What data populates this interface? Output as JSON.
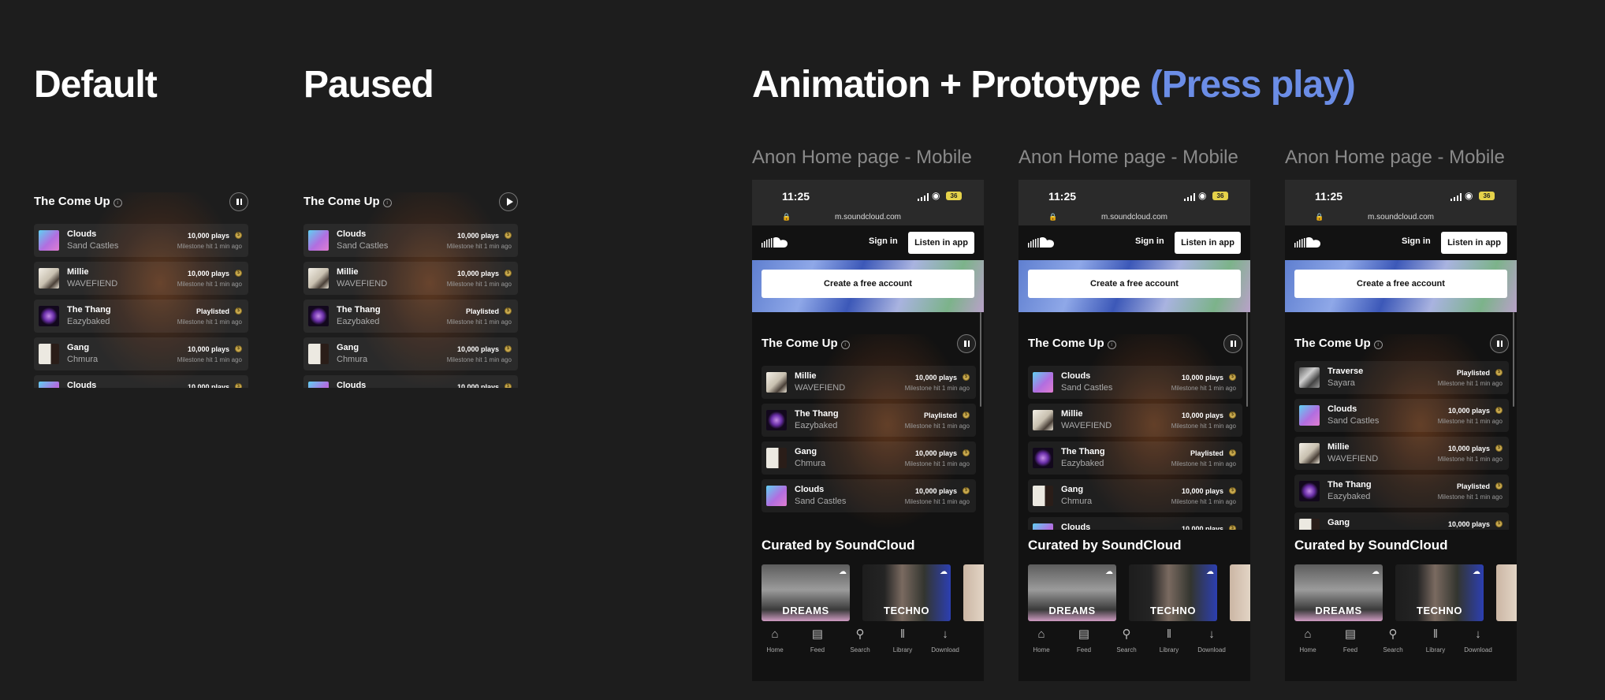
{
  "headings": {
    "default": "Default",
    "paused": "Paused",
    "animation": "Animation + Prototype ",
    "animation_accent": "(Press play)"
  },
  "frame_label": "Anon Home page - Mobile",
  "widget_title": "The Come Up",
  "tracks": {
    "clouds": {
      "name": "Clouds",
      "artist": "Sand Castles",
      "metric": "10,000 plays",
      "sub": "Milestone hit 1 min ago"
    },
    "millie": {
      "name": "Millie",
      "artist": "WAVEFIEND",
      "metric": "10,000 plays",
      "sub": "Milestone hit 1 min ago"
    },
    "thang": {
      "name": "The Thang",
      "artist": "Eazybaked",
      "metric": "Playlisted",
      "sub": "Milestone hit 1 min ago"
    },
    "gang": {
      "name": "Gang",
      "artist": "Chmura",
      "metric": "10,000 plays",
      "sub": "Milestone hit 1 min ago"
    },
    "traverse": {
      "name": "Traverse",
      "artist": "Sayara",
      "metric": "Playlisted",
      "sub": "Milestone hit 1 min ago"
    }
  },
  "phone": {
    "time": "11:25",
    "battery": "36",
    "url": "m.soundcloud.com",
    "sign_in": "Sign in",
    "listen_in_app": "Listen in app",
    "create_account": "Create a free account",
    "curated_title": "Curated by SoundCloud",
    "cards": {
      "dreams": "DREAMS",
      "techno": "TECHNO"
    },
    "tabs": {
      "home": {
        "label": "Home",
        "icon": "home-icon"
      },
      "feed": {
        "label": "Feed",
        "icon": "feed-icon"
      },
      "search": {
        "label": "Search",
        "icon": "search-icon"
      },
      "library": {
        "label": "Library",
        "icon": "library-icon"
      },
      "download": {
        "label": "Download",
        "icon": "download-icon"
      }
    }
  },
  "colors": {
    "background": "#1d1d1d",
    "accent": "#6b8de6",
    "coin": "#c8a94f"
  }
}
